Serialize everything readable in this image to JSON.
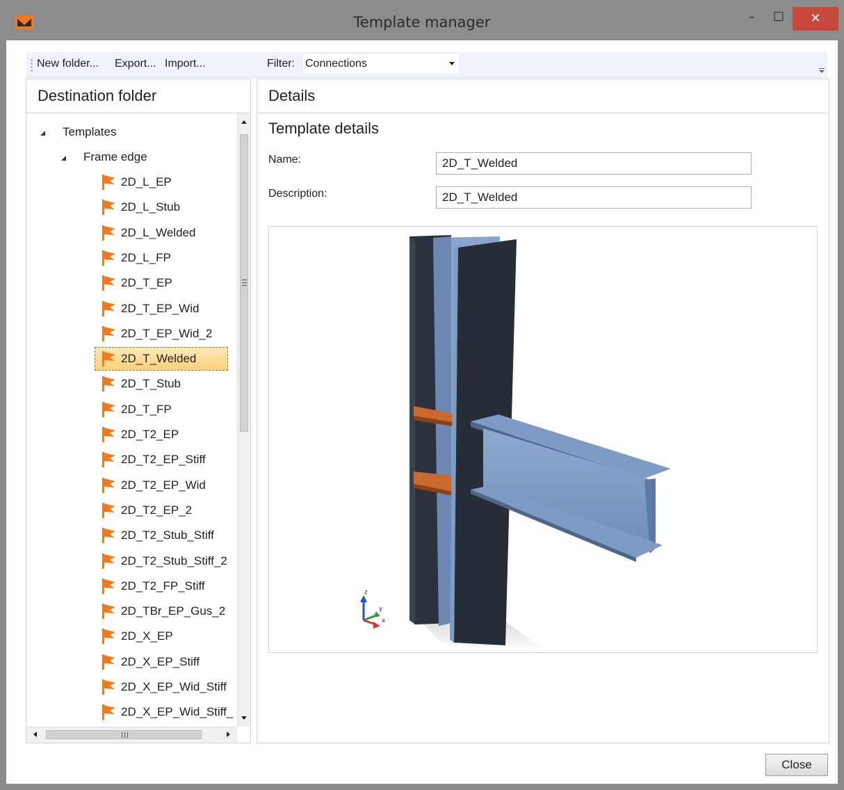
{
  "window": {
    "title": "Template manager",
    "controls": {
      "minimize": "–",
      "maximize": "☐",
      "close": "✕"
    }
  },
  "toolbar": {
    "new_folder": "New folder...",
    "export": "Export...",
    "import": "Import...",
    "filter_label": "Filter:",
    "filter_value": "Connections"
  },
  "left_panel": {
    "title": "Destination folder",
    "tree": {
      "root": "Templates",
      "folder": "Frame edge",
      "items": [
        "2D_L_EP",
        "2D_L_Stub",
        "2D_L_Welded",
        "2D_L_FP",
        "2D_T_EP",
        "2D_T_EP_Wid",
        "2D_T_EP_Wid_2",
        "2D_T_Welded",
        "2D_T_Stub",
        "2D_T_FP",
        "2D_T2_EP",
        "2D_T2_EP_Stiff",
        "2D_T2_EP_Wid",
        "2D_T2_EP_2",
        "2D_T2_Stub_Stiff",
        "2D_T2_Stub_Stiff_2",
        "2D_T2_FP_Stiff",
        "2D_TBr_EP_Gus_2",
        "2D_X_EP",
        "2D_X_EP_Stiff",
        "2D_X_EP_Wid_Stiff",
        "2D_X_EP_Wid_Stiff_"
      ],
      "selected": "2D_T_Welded"
    }
  },
  "right_panel": {
    "title": "Details",
    "section_title": "Template details",
    "name_label": "Name:",
    "name_value": "2D_T_Welded",
    "description_label": "Description:",
    "description_value": "2D_T_Welded",
    "axes": {
      "z": "z",
      "y": "y",
      "x": "x"
    }
  },
  "footer": {
    "close": "Close"
  },
  "colors": {
    "title_bar": "#8c8c8c",
    "close_button": "#c9483e",
    "selection": "#fbd07b",
    "flag": "#f07a1d",
    "steel_dark": "#2b323d",
    "steel_light": "#7d9bc4",
    "stiffener": "#c96a2c"
  }
}
